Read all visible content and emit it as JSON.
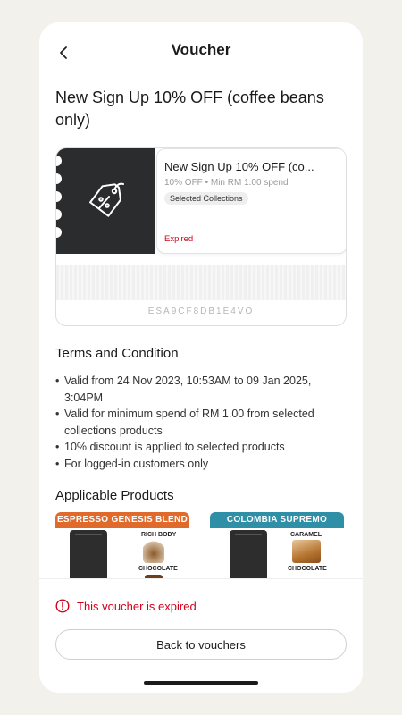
{
  "header": {
    "title": "Voucher",
    "back_icon": "chevron-left-icon"
  },
  "voucher": {
    "title": "New Sign Up 10% OFF (coffee beans only)",
    "card_title": "New Sign Up 10% OFF (co...",
    "discount": "10% OFF",
    "min_spend": "Min RM 1.00 spend",
    "badge": "Selected Collections",
    "status": "Expired",
    "code": "ESA9CF8DB1E4VO",
    "icon": "discount-tag-icon"
  },
  "terms": {
    "title": "Terms and Condition",
    "items": [
      "Valid from 24 Nov 2023, 10:53AM to 09 Jan 2025, 3:04PM",
      "Valid for minimum spend of RM 1.00 from selected collections products",
      "10% discount is applied to selected products",
      "For logged-in customers only"
    ]
  },
  "products": {
    "title": "Applicable Products",
    "items": [
      {
        "name": "ESPRESSO GENESIS BLEND",
        "label_1": "RICH BODY",
        "label_2": "CHOCOLATE",
        "color": "#e06a2b"
      },
      {
        "name": "COLOMBIA SUPREMO",
        "label_1": "CARAMEL",
        "label_2": "CHOCOLATE",
        "color": "#2f8fa6"
      }
    ]
  },
  "footer": {
    "expired_message": "This voucher is expired",
    "back_button": "Back to vouchers",
    "alert_icon": "alert-circle-icon"
  },
  "colors": {
    "danger": "#d0021b",
    "ticket_dark": "#2a2c2d",
    "background": "#f3f1ec"
  }
}
